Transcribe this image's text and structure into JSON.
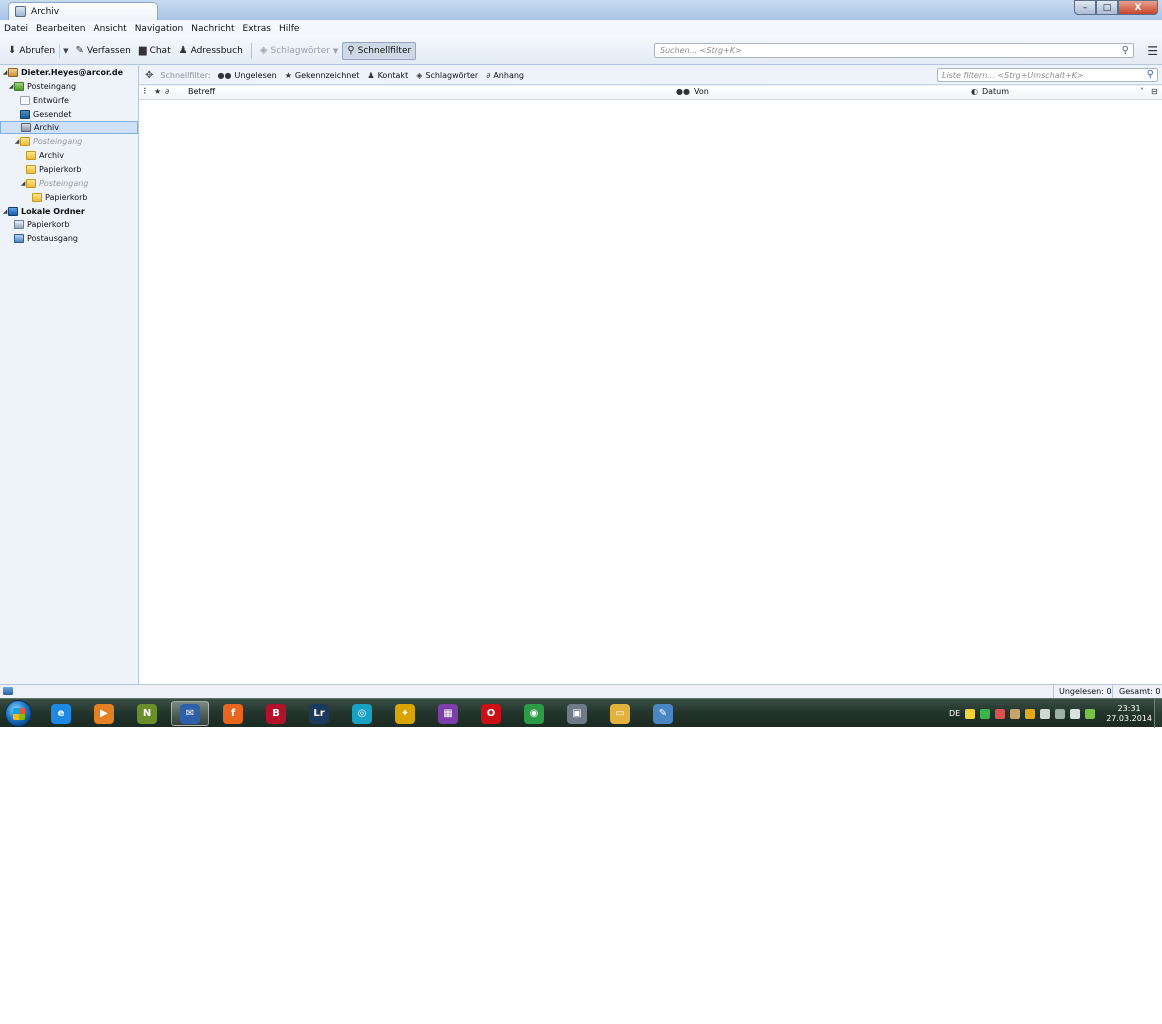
{
  "window": {
    "tab_title": "Archiv",
    "buttons": {
      "minimize": "–",
      "maximize": "□",
      "close": "X"
    },
    "tablist_arrow": "▾"
  },
  "menu": [
    "Datei",
    "Bearbeiten",
    "Ansicht",
    "Navigation",
    "Nachricht",
    "Extras",
    "Hilfe"
  ],
  "toolbar": {
    "get_mail": "Abrufen",
    "compose": "Verfassen",
    "chat": "Chat",
    "address_book": "Adressbuch",
    "tags": "Schlagwörter",
    "quick_filter": "Schnellfilter",
    "search_placeholder": "Suchen... <Strg+K>"
  },
  "folders": [
    {
      "label": "Dieter.Heyes@arcor.de",
      "type": "account",
      "level": 0,
      "twisty": "◢",
      "bold": true
    },
    {
      "label": "Posteingang",
      "type": "inbox",
      "level": 1,
      "twisty": "◢"
    },
    {
      "label": "Entwürfe",
      "type": "draft",
      "level": 2
    },
    {
      "label": "Gesendet",
      "type": "sent",
      "level": 2
    },
    {
      "label": "Archiv",
      "type": "archive",
      "level": 2,
      "selected": true
    },
    {
      "label": "Posteingang",
      "type": "folder",
      "level": 2,
      "twisty": "◢",
      "muted": true
    },
    {
      "label": "Archiv",
      "type": "folder",
      "level": 3
    },
    {
      "label": "Papierkorb",
      "type": "folder",
      "level": 3
    },
    {
      "label": "Posteingang",
      "type": "folder",
      "level": 3,
      "twisty": "◢",
      "muted": true
    },
    {
      "label": "Papierkorb",
      "type": "folder",
      "level": 4
    },
    {
      "label": "Lokale Ordner",
      "type": "local",
      "level": 0,
      "twisty": "◢",
      "bold": true
    },
    {
      "label": "Papierkorb",
      "type": "trash",
      "level": 1
    },
    {
      "label": "Postausgang",
      "type": "outbox",
      "level": 1
    }
  ],
  "quickfilter": {
    "label": "Schnellfilter:",
    "unread": "Ungelesen",
    "starred": "Gekennzeichnet",
    "contact": "Kontakt",
    "tags": "Schlagwörter",
    "attachment": "Anhang",
    "filter_placeholder": "Liste filtern... <Strg+Umschalt+K>"
  },
  "columns": {
    "subject": "Betreff",
    "from": "Von",
    "date": "Datum"
  },
  "statusbar": {
    "unread": "Ungelesen: 0",
    "total": "Gesamt: 0"
  },
  "taskbar": {
    "language": "DE",
    "time": "23:31",
    "date": "27.03.2014",
    "apps": [
      {
        "name": "internet-explorer",
        "glyph": "e",
        "color": "#1e88e5"
      },
      {
        "name": "media-player",
        "glyph": "▶",
        "color": "#e67e22"
      },
      {
        "name": "notepad-plus",
        "glyph": "N",
        "color": "#6a8f2a"
      },
      {
        "name": "thunderbird",
        "glyph": "✉",
        "color": "#2f5fa8",
        "active": true
      },
      {
        "name": "firefox",
        "glyph": "f",
        "color": "#e8661d"
      },
      {
        "name": "app-red",
        "glyph": "B",
        "color": "#b3122a"
      },
      {
        "name": "lightroom",
        "glyph": "Lr",
        "color": "#1c3a5a"
      },
      {
        "name": "app-teal",
        "glyph": "◎",
        "color": "#17a2c4"
      },
      {
        "name": "app-yellow",
        "glyph": "✦",
        "color": "#d8a400"
      },
      {
        "name": "app-multicolor",
        "glyph": "▦",
        "color": "#7b3fa8"
      },
      {
        "name": "opera",
        "glyph": "O",
        "color": "#cc0f16"
      },
      {
        "name": "chrome",
        "glyph": "◉",
        "color": "#2e9b48"
      },
      {
        "name": "photo-app",
        "glyph": "▣",
        "color": "#6f7c88"
      },
      {
        "name": "explorer",
        "glyph": "▭",
        "color": "#e2b23c"
      },
      {
        "name": "paint",
        "glyph": "✎",
        "color": "#4b86c4"
      }
    ]
  }
}
